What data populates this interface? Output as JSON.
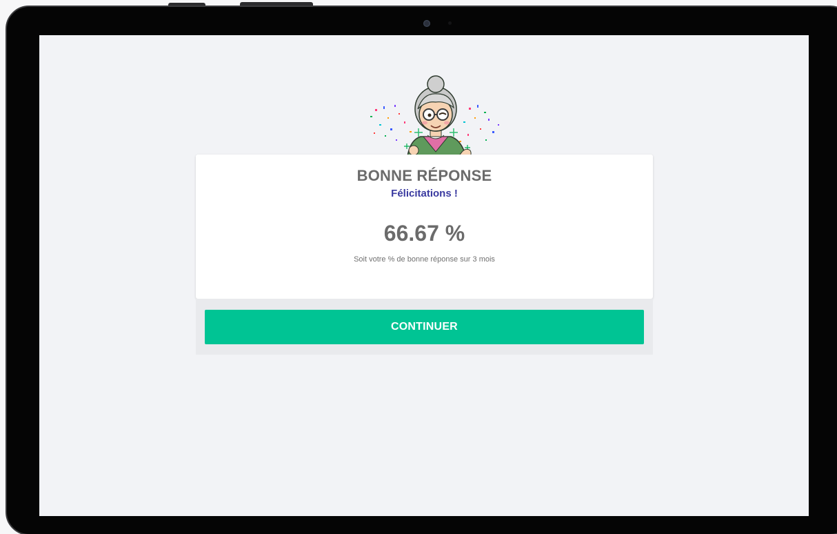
{
  "result": {
    "title": "BONNE RÉPONSE",
    "subtitle": "Félicitations !",
    "percentage": "66.67 %",
    "caption": "Soit votre % de bonne réponse sur 3 mois"
  },
  "actions": {
    "continue_label": "CONTINUER"
  },
  "mascot": {
    "icon": "grandmother-mascot-icon",
    "decoration": "confetti-icon"
  },
  "colors": {
    "accent_button": "#00c494",
    "subtitle": "#3a3aa0",
    "title": "#6b6b6b",
    "screen_background": "#f2f3f6",
    "card_background": "#ffffff"
  }
}
